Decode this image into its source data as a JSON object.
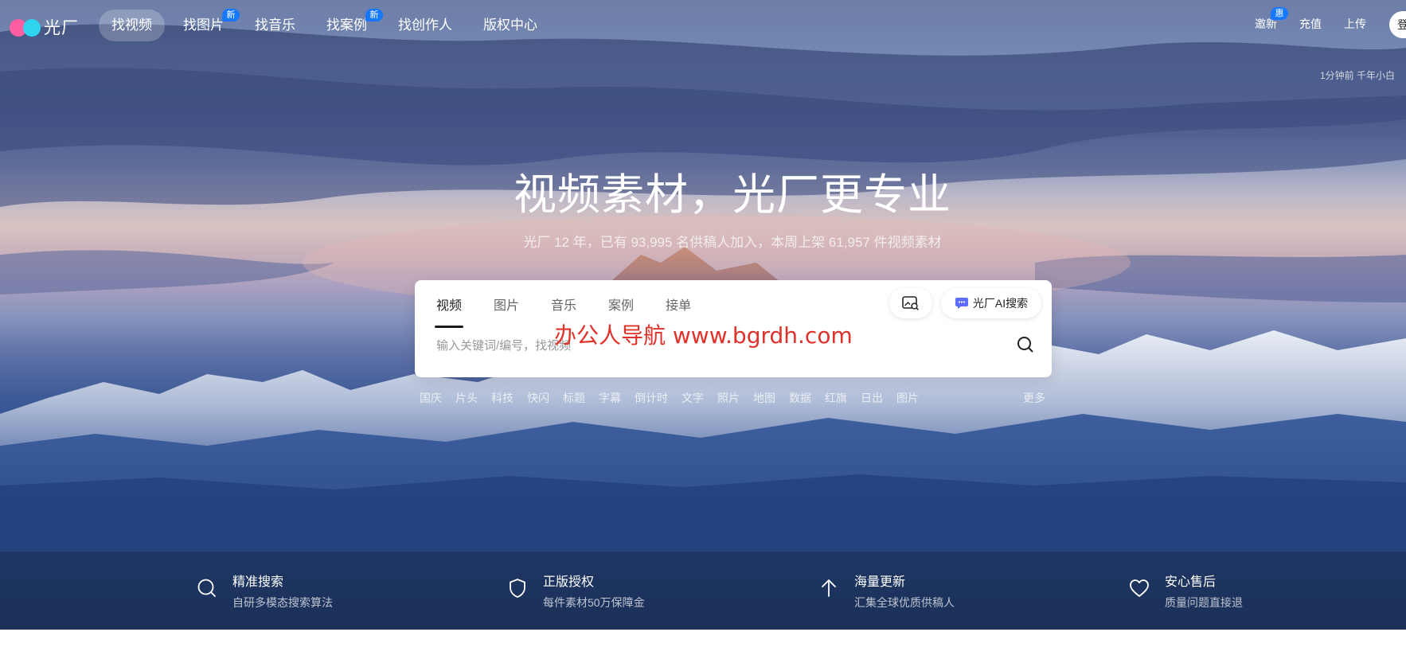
{
  "brand": {
    "name": "光厂"
  },
  "nav": {
    "items": [
      {
        "label": "找视频",
        "active": true,
        "badge": ""
      },
      {
        "label": "找图片",
        "active": false,
        "badge": "新"
      },
      {
        "label": "找音乐",
        "active": false,
        "badge": ""
      },
      {
        "label": "找案例",
        "active": false,
        "badge": "新"
      },
      {
        "label": "找创作人",
        "active": false,
        "badge": ""
      },
      {
        "label": "版权中心",
        "active": false,
        "badge": ""
      }
    ],
    "right": {
      "invite": "邀新",
      "invite_badge": "惠",
      "recharge": "充值",
      "upload": "上传",
      "login": "登"
    },
    "ticker": "1分钟前 千年小白"
  },
  "hero": {
    "headline": "视频素材，光厂更专业",
    "subline": "光厂  12  年，已有 93,995 名供稿人加入，本周上架 61,957 件视频素材"
  },
  "search": {
    "tabs": [
      "视频",
      "图片",
      "音乐",
      "案例",
      "接单"
    ],
    "active_tab": "视频",
    "ai_button": "光厂AI搜索",
    "placeholder": "输入关键词/编号，找视频",
    "value": ""
  },
  "watermark": "办公人导航  www.bgrdh.com",
  "hot_tags": [
    "国庆",
    "片头",
    "科技",
    "快闪",
    "标题",
    "字幕",
    "倒计时",
    "文字",
    "照片",
    "地图",
    "数据",
    "红旗",
    "日出",
    "图片"
  ],
  "more_label": "更多",
  "features": [
    {
      "icon": "search-icon",
      "title": "精准搜索",
      "desc": "自研多模态搜索算法"
    },
    {
      "icon": "shield-icon",
      "title": "正版授权",
      "desc": "每件素材50万保障金"
    },
    {
      "icon": "arrow-up-icon",
      "title": "海量更新",
      "desc": "汇集全球优质供稿人"
    },
    {
      "icon": "heart-icon",
      "title": "安心售后",
      "desc": "质量问题直接退"
    }
  ],
  "colors": {
    "accent": "#1677ff",
    "watermark": "#e0322a",
    "feature_bar": "#1e3764"
  }
}
